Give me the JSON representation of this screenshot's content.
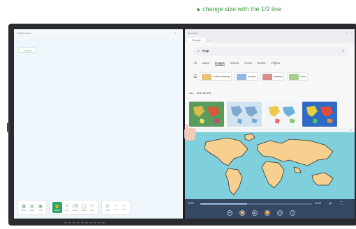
{
  "caption": {
    "text": "change size with the 1/2 line"
  },
  "left_app": {
    "window_title": "Whiteboard",
    "window_controls": [
      "–",
      "□",
      "×"
    ],
    "chip_label": "Tutorial",
    "toolbar_groups": [
      [
        {
          "icon": "▦",
          "label": "Menu"
        },
        {
          "icon": "▤",
          "label": "Pages"
        },
        {
          "icon": "▣",
          "label": "Add"
        }
      ],
      [
        {
          "icon": "☝",
          "label": "Select",
          "active": true
        },
        {
          "icon": "✎",
          "label": "Pen"
        },
        {
          "icon": "⌫",
          "label": "Eraser"
        },
        {
          "icon": "◯",
          "label": "Shape"
        },
        {
          "icon": "↶",
          "label": "Undo"
        }
      ],
      [
        {
          "icon": "◎",
          "label": "Tools"
        },
        {
          "icon": "‹",
          "label": "Prev"
        },
        {
          "icon": "›",
          "label": "Next"
        }
      ]
    ]
  },
  "right_app": {
    "window_title": "Browser",
    "window_controls": [
      "–",
      "□",
      "×"
    ],
    "tab_label": "Google",
    "new_tab": "+",
    "search_query": "map",
    "filters": [
      "All",
      "Maps",
      "Images",
      "Videos",
      "News",
      "Books",
      "Flights"
    ],
    "active_filter": "Images",
    "image_chips": [
      "outline drawing",
      "europe",
      "america",
      "india"
    ],
    "section_label": "ALL · SEE MORE",
    "video": {
      "time_current": "00:18",
      "time_total": "00:48",
      "progress": 0.42,
      "buttons": [
        "⏮",
        "⏪",
        "▶",
        "⏩",
        "⏭",
        "↻"
      ]
    }
  },
  "colors": {
    "accent_green": "#2fa66b",
    "caption_green": "#3a9a3a",
    "ocean": "#7fd0dc",
    "land": "#f7cf8f"
  }
}
